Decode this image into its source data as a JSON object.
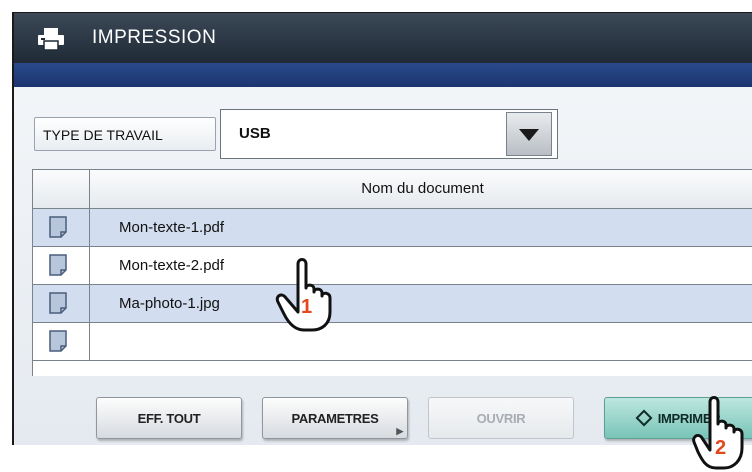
{
  "window": {
    "title": "IMPRESSION",
    "title_icon": "printer-icon"
  },
  "job_type": {
    "label": "TYPE DE TRAVAIL",
    "value": "USB",
    "dropdown_icon": "chevron-down-icon"
  },
  "file_table": {
    "column_header": "Nom du document",
    "row_icon": "document-icon",
    "rows": [
      {
        "name": "Mon-texte-1.pdf",
        "selected": true
      },
      {
        "name": "Mon-texte-2.pdf",
        "selected": false
      },
      {
        "name": "Ma-photo-1.jpg",
        "selected": true
      },
      {
        "name": "",
        "selected": false
      }
    ]
  },
  "buttons": {
    "clear_all": "EFF. TOUT",
    "settings": "PARAMETRES",
    "open": "OUVRIR",
    "print": "IMPRIMER"
  },
  "annotations": {
    "step_1": "1",
    "step_2": "2",
    "pointer_icon": "hand-pointer-icon"
  },
  "colors": {
    "title_bar": "#1f2a36",
    "accent_bar": "#1c3570",
    "selected_row": "#d2deef",
    "print_button": "#79c4b8",
    "step_number": "#e2481a"
  }
}
